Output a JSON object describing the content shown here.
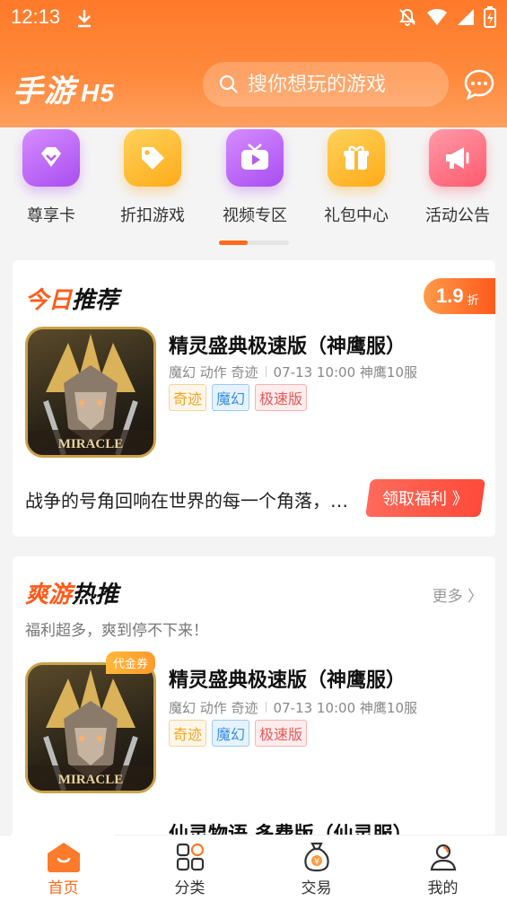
{
  "status_bar": {
    "time": "12:13"
  },
  "header": {
    "logo_main": "手游",
    "logo_h5": "H5",
    "search_placeholder": "搜你想玩的游戏"
  },
  "categories": [
    {
      "label": "尊享卡",
      "icon": "diamond-icon",
      "color": "#b65cf0"
    },
    {
      "label": "折扣游戏",
      "icon": "tag-icon",
      "color": "#ffb82a"
    },
    {
      "label": "视频专区",
      "icon": "video-icon",
      "color": "#b65cf0"
    },
    {
      "label": "礼包中心",
      "icon": "gift-icon",
      "color": "#ffb82a"
    },
    {
      "label": "活动公告",
      "icon": "megaphone-icon",
      "color": "#ff6a7a"
    }
  ],
  "today": {
    "title_hl": "今日",
    "title_rest": "推荐",
    "discount_value": "1.9",
    "discount_unit": "折",
    "game": {
      "name": "精灵盛典极速版（神鹰服）",
      "genres": "魔幻 动作 奇迹",
      "server": "07-13 10:00 神鹰10服",
      "tags": [
        "奇迹",
        "魔幻",
        "极速版"
      ],
      "icon_text": "MIRACLE"
    },
    "description": "战争的号角回响在世界的每一个角落，…",
    "welfare_button": "领取福利 》"
  },
  "hot": {
    "title_hl": "爽游",
    "title_rest": "热推",
    "more_label": "更多 〉",
    "subtitle": "福利超多，爽到停不下来！",
    "voucher_badge": "代金券",
    "game": {
      "name": "精灵盛典极速版（神鹰服）",
      "genres": "魔幻 动作 奇迹",
      "server": "07-13 10:00 神鹰10服",
      "tags": [
        "奇迹",
        "魔幻",
        "极速版"
      ],
      "icon_text": "MIRACLE"
    },
    "next_game_peek": "仙灵物语 多费版（仙灵服）"
  },
  "tabbar": [
    {
      "label": "首页",
      "icon": "home-icon",
      "active": true
    },
    {
      "label": "分类",
      "icon": "category-icon",
      "active": false
    },
    {
      "label": "交易",
      "icon": "money-bag-icon",
      "active": false
    },
    {
      "label": "我的",
      "icon": "profile-icon",
      "active": false
    }
  ],
  "colors": {
    "accent": "#ff6a1a",
    "header_top": "#ff7a2a"
  }
}
